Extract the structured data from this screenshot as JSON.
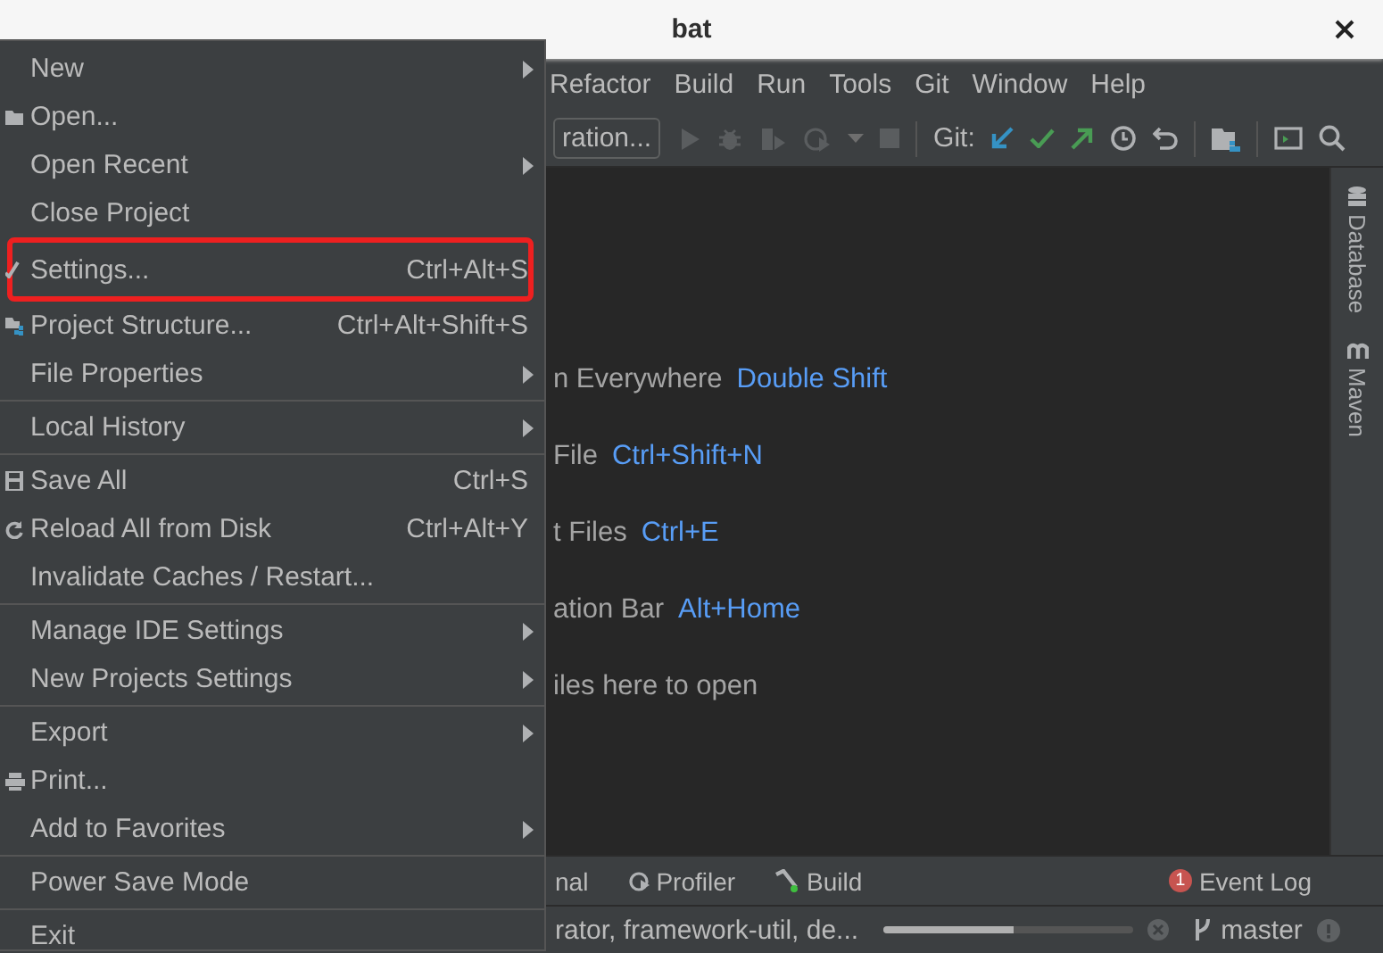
{
  "window": {
    "title": "bat"
  },
  "menu_bar": [
    {
      "label": "Refactor"
    },
    {
      "label": "Build"
    },
    {
      "label": "Run"
    },
    {
      "label": "Tools"
    },
    {
      "label": "Git"
    },
    {
      "label": "Window"
    },
    {
      "label": "Help"
    }
  ],
  "toolbar": {
    "run_config": "ration...",
    "git_label": "Git:"
  },
  "file_menu": [
    [
      {
        "label": "New",
        "submenu": true,
        "highlighted": false
      },
      {
        "label": "Open...",
        "submenu": false,
        "highlighted": false
      },
      {
        "label": "Open Recent",
        "submenu": true,
        "highlighted": false
      },
      {
        "label": "Close Project",
        "submenu": false,
        "highlighted": false
      },
      {
        "label": "Settings...",
        "shortcut": "Ctrl+Alt+S",
        "submenu": false,
        "highlighted": true
      },
      {
        "label": "Project Structure...",
        "shortcut": "Ctrl+Alt+Shift+S",
        "submenu": false,
        "highlighted": false
      },
      {
        "label": "File Properties",
        "submenu": true,
        "highlighted": false
      }
    ],
    [
      {
        "label": "Local History",
        "submenu": true,
        "highlighted": false
      }
    ],
    [
      {
        "label": "Save All",
        "shortcut": "Ctrl+S",
        "submenu": false,
        "highlighted": false
      },
      {
        "label": "Reload All from Disk",
        "shortcut": "Ctrl+Alt+Y",
        "submenu": false,
        "highlighted": false
      },
      {
        "label": "Invalidate Caches / Restart...",
        "submenu": false,
        "highlighted": false
      }
    ],
    [
      {
        "label": "Manage IDE Settings",
        "submenu": true,
        "highlighted": false
      },
      {
        "label": "New Projects Settings",
        "submenu": true,
        "highlighted": false
      }
    ],
    [
      {
        "label": "Export",
        "submenu": true,
        "highlighted": false
      },
      {
        "label": "Print...",
        "submenu": false,
        "highlighted": false
      },
      {
        "label": "Add to Favorites",
        "submenu": true,
        "highlighted": false
      }
    ],
    [
      {
        "label": "Power Save Mode",
        "submenu": false,
        "highlighted": false
      }
    ],
    [
      {
        "label": "Exit",
        "submenu": false,
        "highlighted": false
      }
    ]
  ],
  "editor_hints": [
    {
      "text": "n Everywhere",
      "shortcut": "Double Shift"
    },
    {
      "text": "File",
      "shortcut": "Ctrl+Shift+N"
    },
    {
      "text": "t Files",
      "shortcut": "Ctrl+E"
    },
    {
      "text": "ation Bar",
      "shortcut": "Alt+Home"
    },
    {
      "text": "iles here to open"
    }
  ],
  "right_stripe": [
    {
      "label": "Database"
    },
    {
      "label": "Maven"
    }
  ],
  "tool_windows": [
    {
      "label": "nal"
    },
    {
      "label": "Profiler"
    },
    {
      "label": "Build"
    }
  ],
  "event_log": {
    "label": "Event Log",
    "badge": "1"
  },
  "status_bar": {
    "task": "rator, framework-util, de...",
    "progress": {
      "level": 0.52
    },
    "branch": "master"
  }
}
